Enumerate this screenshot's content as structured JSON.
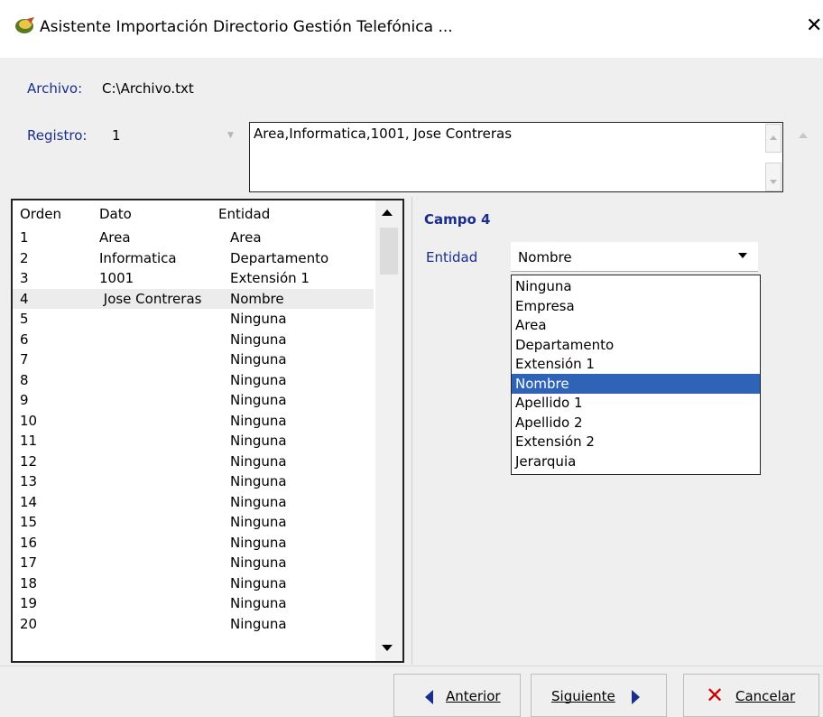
{
  "window": {
    "title": "Asistente Importación Directorio Gestión Telefónica ...",
    "close_label": "✕"
  },
  "archivo": {
    "label": "Archivo:",
    "value": "C:\\Archivo.txt"
  },
  "registro": {
    "label": "Registro:",
    "value": "1",
    "record_text": "Area,Informatica,1001, Jose Contreras"
  },
  "grid": {
    "headers": [
      "Orden",
      "Dato",
      "Entidad"
    ],
    "rows": [
      [
        "1",
        "Area",
        "Area"
      ],
      [
        "2",
        "Informatica",
        "Departamento"
      ],
      [
        "3",
        "1001",
        "Extensión 1"
      ],
      [
        "4",
        " Jose Contreras",
        "Nombre"
      ],
      [
        "5",
        "",
        "Ninguna"
      ],
      [
        "6",
        "",
        "Ninguna"
      ],
      [
        "7",
        "",
        "Ninguna"
      ],
      [
        "8",
        "",
        "Ninguna"
      ],
      [
        "9",
        "",
        "Ninguna"
      ],
      [
        "10",
        "",
        "Ninguna"
      ],
      [
        "11",
        "",
        "Ninguna"
      ],
      [
        "12",
        "",
        "Ninguna"
      ],
      [
        "13",
        "",
        "Ninguna"
      ],
      [
        "14",
        "",
        "Ninguna"
      ],
      [
        "15",
        "",
        "Ninguna"
      ],
      [
        "16",
        "",
        "Ninguna"
      ],
      [
        "17",
        "",
        "Ninguna"
      ],
      [
        "18",
        "",
        "Ninguna"
      ],
      [
        "19",
        "",
        "Ninguna"
      ],
      [
        "20",
        "",
        "Ninguna"
      ]
    ],
    "selected_row": 3
  },
  "campo": {
    "title": "Campo 4",
    "entidad_label": "Entidad",
    "selected_value": "Nombre",
    "options": [
      "Ninguna",
      "Empresa",
      "Area",
      "Departamento",
      "Extensión 1",
      "Nombre",
      "Apellido 1",
      "Apellido 2",
      "Extensión 2",
      "Jerarquia"
    ],
    "highlighted_option": 5
  },
  "buttons": {
    "anterior": "Anterior",
    "siguiente": "Siguiente",
    "cancelar": "Cancelar"
  },
  "colors": {
    "label_blue": "#1a2e8c",
    "selection_blue": "#2e63b8",
    "cancel_red": "#d00000"
  }
}
